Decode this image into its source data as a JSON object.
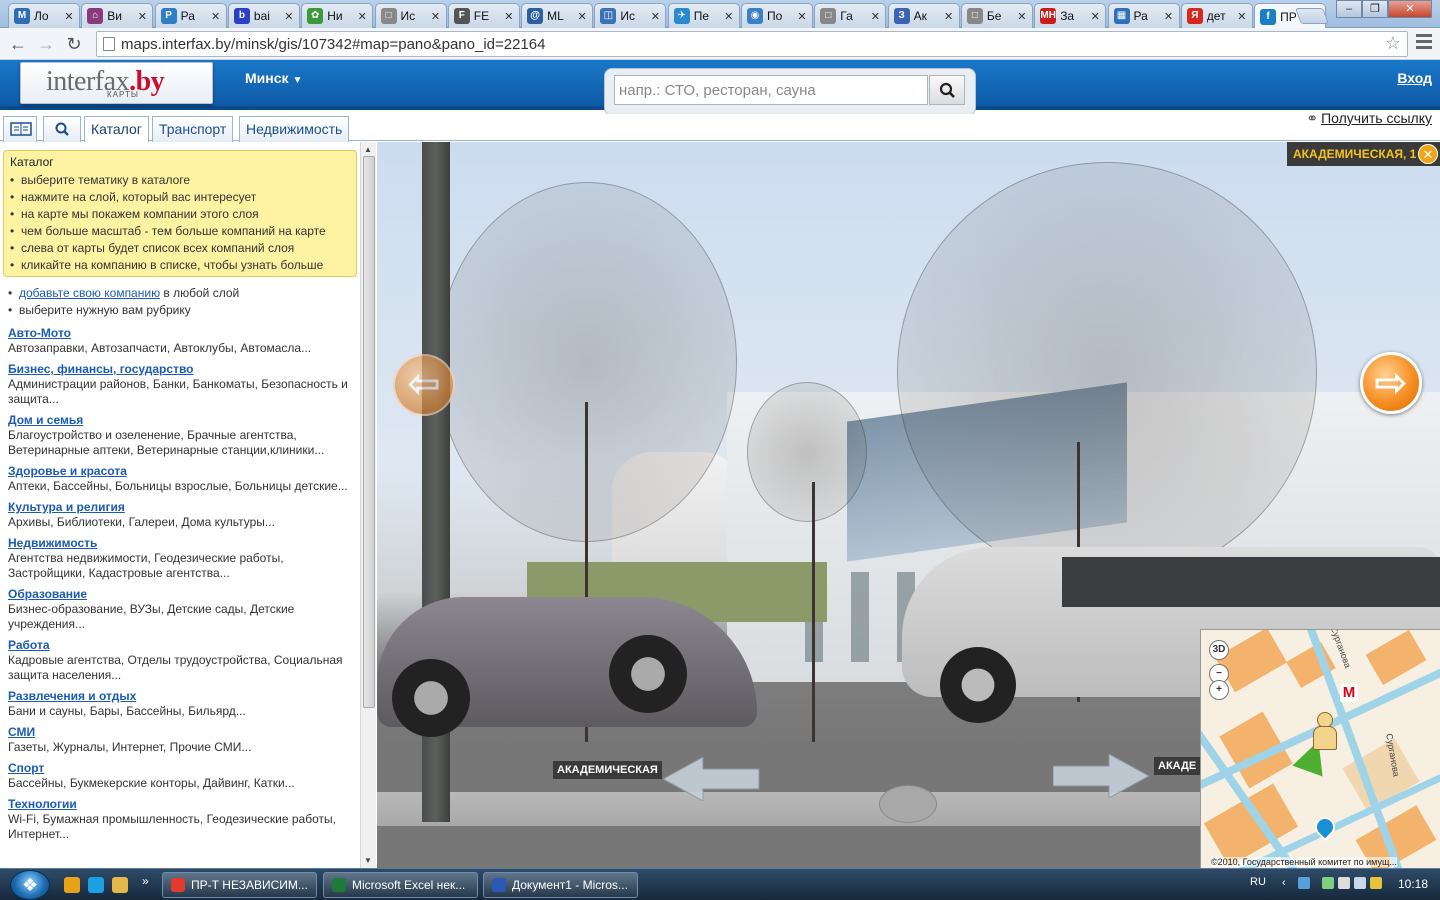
{
  "browser": {
    "tabs": [
      {
        "label": "Ло",
        "favicon": "M",
        "color": "#2d6db5"
      },
      {
        "label": "Ви",
        "favicon": "⌂",
        "color": "#8a3b7c"
      },
      {
        "label": "Ра",
        "favicon": "P",
        "color": "#2f7fc8"
      },
      {
        "label": "bai",
        "favicon": "b",
        "color": "#2c3fc7"
      },
      {
        "label": "Ни",
        "favicon": "✿",
        "color": "#3c9a3c"
      },
      {
        "label": "Ис",
        "favicon": "□",
        "color": "#888888"
      },
      {
        "label": "FE",
        "favicon": "F",
        "color": "#555555"
      },
      {
        "label": "ML",
        "favicon": "@",
        "color": "#2d5fa0"
      },
      {
        "label": "Ис",
        "favicon": "◫",
        "color": "#3a72b8"
      },
      {
        "label": "Пе",
        "favicon": "✈",
        "color": "#2a8ad0"
      },
      {
        "label": "По",
        "favicon": "◉",
        "color": "#3a80c8"
      },
      {
        "label": "Га",
        "favicon": "□",
        "color": "#888888"
      },
      {
        "label": "Ак",
        "favicon": "З",
        "color": "#3a63b5"
      },
      {
        "label": "Бе",
        "favicon": "□",
        "color": "#888888"
      },
      {
        "label": "За",
        "favicon": "МН",
        "color": "#c81e1e"
      },
      {
        "label": "Ра",
        "favicon": "▦",
        "color": "#2f6fb7"
      },
      {
        "label": "дет",
        "favicon": "Я",
        "color": "#d5281e"
      },
      {
        "label": "ПР",
        "favicon": "f",
        "color": "#1a7fc4"
      }
    ],
    "url": "maps.interfax.by/minsk/gis/107342#map=pano&pano_id=22164",
    "back_icon": "arrow-left-icon",
    "forward_icon": "arrow-right-icon",
    "reload_icon": "reload-icon",
    "star_icon": "star-icon"
  },
  "site": {
    "logo_main": "interfax",
    "logo_tld": ".by",
    "logo_sub": "КАРТЫ",
    "city": "Минск",
    "search_placeholder": "напр.: СТО, ресторан, сауна",
    "login": "Вход",
    "get_link": "Получить ссылку",
    "tabs": [
      "Каталог",
      "Транспорт",
      "Недвижимость"
    ]
  },
  "catalog": {
    "tip_title": "Каталог",
    "tips": [
      "выберите тематику в каталоге",
      "нажмите на слой, который вас интересует",
      "на карте мы покажем компании этого слоя",
      "чем больше масштаб - тем больше компаний на карте",
      "слева от карты будет список всех компаний слоя",
      "кликайте на компанию в списке, чтобы узнать больше"
    ],
    "add_link": "добавьте свою компанию",
    "add_suffix": " в любой слой",
    "choose": "выберите нужную вам рубрику",
    "categories": [
      {
        "name": "Авто-Мото",
        "desc": "Автозаправки, Автозапчасти, Автоклубы, Автомасла..."
      },
      {
        "name": "Бизнес, финансы, государство",
        "desc": "Администрации районов, Банки, Банкоматы, Безопасность и защита..."
      },
      {
        "name": "Дом и семья",
        "desc": "Благоустройство и озеленение, Брачные агентства, Ветеринарные аптеки, Ветеринарные станции,клиники..."
      },
      {
        "name": "Здоровье и красота",
        "desc": "Аптеки, Бассейны, Больницы взрослые, Больницы детские..."
      },
      {
        "name": "Культура и религия",
        "desc": "Архивы, Библиотеки, Галереи, Дома культуры..."
      },
      {
        "name": "Недвижимость",
        "desc": "Агентства недвижимости, Геодезические работы, Застройщики, Кадастровые агентства..."
      },
      {
        "name": "Образование",
        "desc": "Бизнес-образование, ВУЗы, Детские сады, Детские учреждения..."
      },
      {
        "name": "Работа",
        "desc": "Кадровые агентства, Отделы трудоустройства, Социальная защита населения..."
      },
      {
        "name": "Развлечения и отдых",
        "desc": "Бани и сауны, Бары, Бассейны, Бильярд..."
      },
      {
        "name": "СМИ",
        "desc": "Газеты, Журналы, Интернет, Прочие СМИ..."
      },
      {
        "name": "Спорт",
        "desc": "Бассейны, Букмекерские конторы, Дайвинг, Катки..."
      },
      {
        "name": "Технологии",
        "desc": "Wi-Fi, Бумажная промышленность, Геодезические работы, Интернет..."
      }
    ]
  },
  "pano": {
    "address": "АКАДЕМИЧЕСКАЯ, 1",
    "street_left": "АКАДЕМИЧЕСКАЯ",
    "street_right": "АКАДЕ",
    "minimap": {
      "btn_3d": "3D",
      "zoom_out": "−",
      "zoom_in": "+",
      "metro": "М",
      "street1": "Сурганова",
      "street2": "Сурганова",
      "copyright": "©2010, Государственный комитет по имущ..."
    }
  },
  "taskbar": {
    "items": [
      {
        "label": "ПР-Т НЕЗАВИСИМ...",
        "color": "#e23b2e"
      },
      {
        "label": "Microsoft Excel нек...",
        "color": "#1f7a3a"
      },
      {
        "label": "Документ1 - Micros...",
        "color": "#2a5ab5"
      }
    ],
    "chevron": "»",
    "lang": "RU",
    "time": "10:18"
  }
}
